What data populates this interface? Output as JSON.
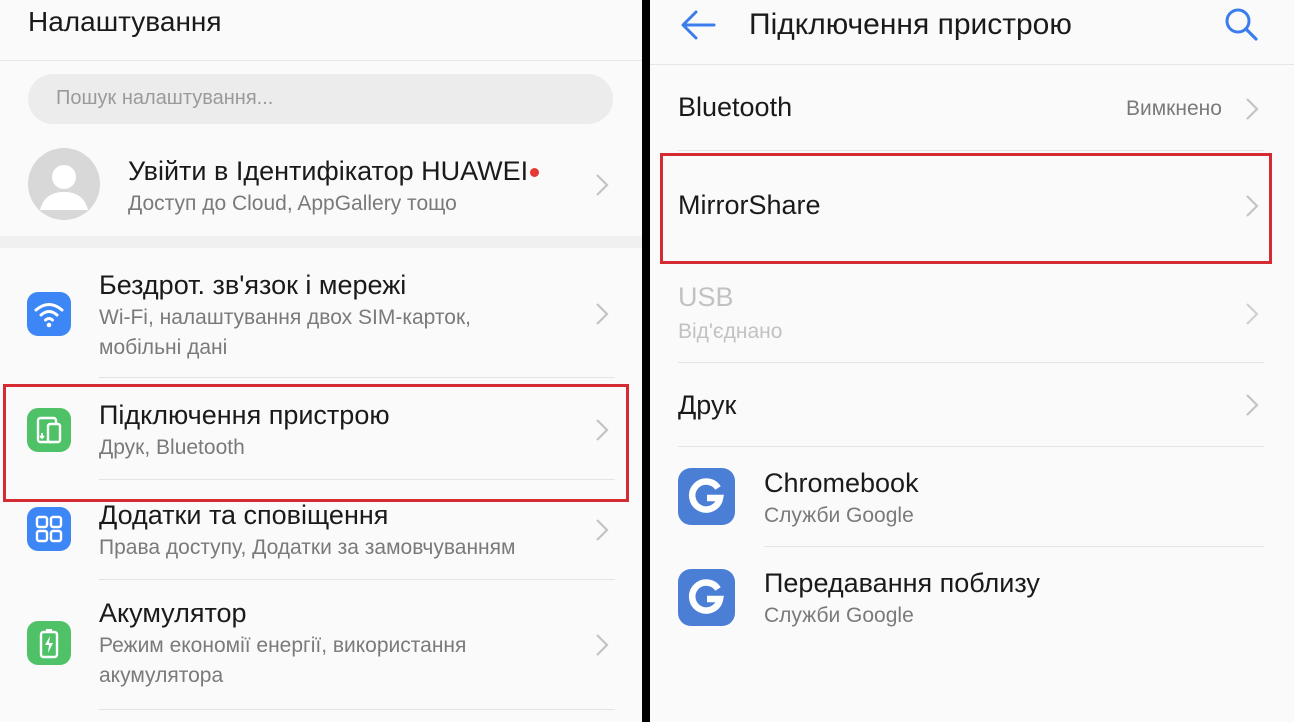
{
  "left": {
    "header_title": "Налаштування",
    "search_placeholder": "Пошук налаштування...",
    "account": {
      "title": "Увійти в Ідентифікатор HUAWEI",
      "subtitle": "Доступ до Cloud, AppGallery тощо"
    },
    "items": [
      {
        "title": "Бездрот. зв'язок і мережі",
        "subtitle_line1": "Wi-Fi, налаштування двох SIM-карток,",
        "subtitle_line2": "мобільні дані",
        "icon": "wifi-icon",
        "color": "#3d86f6"
      },
      {
        "title": "Підключення пристрою",
        "subtitle": "Друк, Bluetooth",
        "icon": "device-connection-icon",
        "color": "#4fc268"
      },
      {
        "title": "Додатки та сповіщення",
        "subtitle": "Права доступу, Додатки за замовчуванням",
        "icon": "apps-grid-icon",
        "color": "#3d86f6"
      },
      {
        "title": "Акумулятор",
        "subtitle_line1": "Режим економії енергії, використання",
        "subtitle_line2": "акумулятора",
        "icon": "battery-icon",
        "color": "#4fc268"
      }
    ]
  },
  "right": {
    "header_title": "Підключення пристрою",
    "back_icon": "back-arrow-icon",
    "search_icon": "search-icon",
    "accent_color": "#3b7ded",
    "items": [
      {
        "title": "Bluetooth",
        "value": "Вимкнено"
      },
      {
        "title": "MirrorShare"
      },
      {
        "title": "USB",
        "subtitle": "Від'єднано",
        "disabled": true
      },
      {
        "title": "Друк"
      },
      {
        "title": "Chromebook",
        "subtitle": "Служби Google",
        "icon": "google-g-icon"
      },
      {
        "title": "Передавання поблизу",
        "subtitle": "Служби Google",
        "icon": "google-g-icon"
      }
    ]
  },
  "highlight_color": "#d42a31",
  "notification_dot_color": "#e53935"
}
